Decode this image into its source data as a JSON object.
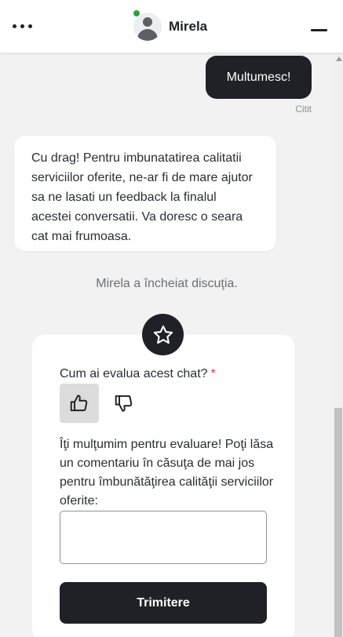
{
  "header": {
    "agent_name": "Mirela",
    "status": "online",
    "status_color": "#2ea043",
    "menu_icon": "more-horizontal-icon",
    "minimize_icon": "minimize-icon"
  },
  "messages": [
    {
      "direction": "outgoing",
      "text": "Multumesc!",
      "status": "Citit"
    },
    {
      "direction": "incoming",
      "text": "Cu drag! Pentru imbunatatirea calitatii serviciilor oferite, ne-ar fi de mare ajutor sa ne lasati un feedback la finalul acestei conversatii. Va doresc o seara cat mai frumoasa."
    }
  ],
  "system_message": "Mirela a încheiat discuţia.",
  "rating": {
    "icon": "star-icon",
    "question": "Cum ai evalua acest chat?",
    "required_mark": "*",
    "options": [
      {
        "name": "thumbs-up",
        "icon": "thumbs-up-icon",
        "selected": true
      },
      {
        "name": "thumbs-down",
        "icon": "thumbs-down-icon",
        "selected": false
      }
    ],
    "thanks_text": "Îţi mulţumim pentru evaluare! Poţi lăsa un comentariu în căsuţa de mai jos pentru îmbunătăţirea calităţii serviciilor oferite:",
    "comment_value": "",
    "submit_label": "Trimitere"
  },
  "colors": {
    "primary": "#1f2127",
    "background": "#f2f2f2",
    "required": "#d93a3a"
  }
}
